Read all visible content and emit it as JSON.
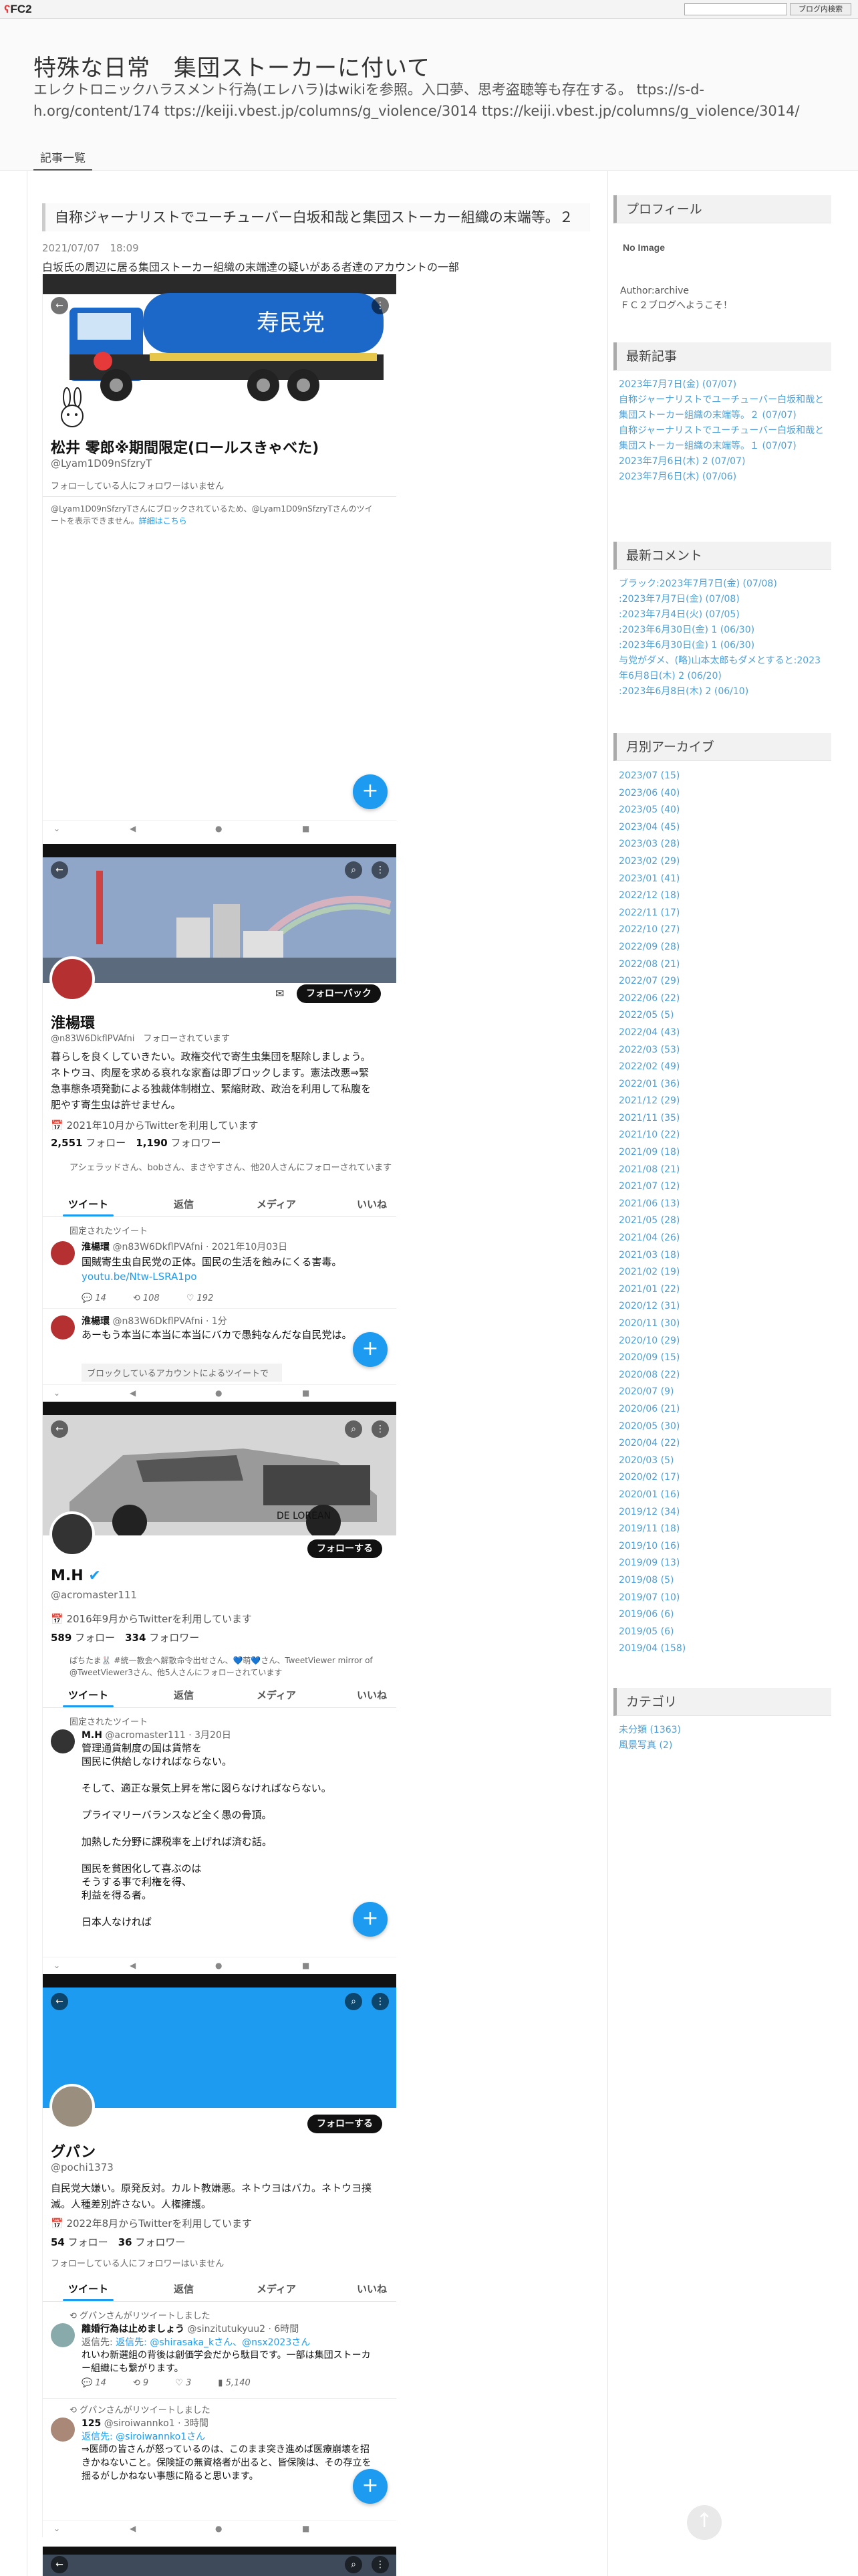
{
  "fc2": {
    "logo": "FC2",
    "search_button": "ブログ内検索"
  },
  "blog": {
    "title": "特殊な日常　集団ストーカーに付いて",
    "description": "エレクトロニックハラスメント行為(エレハラ)はwikiを参照。入口夢、思考盗聴等も存在する。 ttps://s-d-h.org/content/174 ttps://keiji.vbest.jp/columns/g_violence/3014 ttps://keiji.vbest.jp/columns/g_violence/3014/",
    "entry_list": "記事一覧"
  },
  "post": {
    "title": "自称ジャーナリストでユーチューバー白坂和哉と集団ストーカー組織の末端等。２",
    "date": "2021/07/07　18:09",
    "caption": "白坂氏の周辺に居る集団ストーカー組織の末端達の疑いがある者達のアカウントの一部"
  },
  "shot1": {
    "truck_text": "寿民党",
    "name": "松井 零郎※期間限定(ロールスきゃべた)",
    "handle": "@Lyam1D09nSfzryT",
    "follow_note": "フォローしている人にフォロワーはいません",
    "blocked": "@Lyam1D09nSfzryTさんにブロックされているため、@Lyam1D09nSfzryTさんのツイートを表示できません。",
    "blocked_link": "詳細はこちら"
  },
  "shot2": {
    "follow_back": "フォローバック",
    "name": "淮楊環",
    "handle": "@n83W6DkflPVAfni",
    "followed_badge": "フォローされています",
    "bio": "暮らしを良くしていきたい。政権交代で寄生虫集団を駆除しましょう。ネトウヨ、肉屋を求める哀れな家畜は即ブロックします。憲法改悪⇒緊急事態条項発動による独裁体制樹立、緊縮財政、政治を利用して私腹を肥やす寄生虫は許せません。",
    "joined": "2021年10月からTwitterを利用しています",
    "following": "2,551",
    "following_label": "フォロー",
    "followers": "1,190",
    "followers_label": "フォロワー",
    "followed_by": "アシェラッドさん、bobさん、まさやすさん、他20人さんにフォローされています",
    "tabs": [
      "ツイート",
      "返信",
      "メディア",
      "いいね"
    ],
    "pinned": "固定されたツイート",
    "tweet1_header": "淮楊環",
    "tweet1_meta": "@n83W6DkflPVAfni · 2021年10月03日",
    "tweet1_body": "国賊寄生虫自民党の正体。国民の生活を蝕みにくる害毒。",
    "tweet1_link": "youtu.be/Ntw-LSRA1po",
    "tweet1_stats": [
      "14",
      "108",
      "192"
    ],
    "tweet2_header": "淮楊環",
    "tweet2_meta": "@n83W6DkflPVAfni · 1分",
    "tweet2_body": "あーもう本当に本当に本当にバカで愚鈍なんだな自民党は。",
    "tweet2_blocked": "ブロックしているアカウントによるツイートで"
  },
  "shot3": {
    "car_text": "DE LOREAN",
    "follow_button": "フォローする",
    "name": "M.H",
    "handle": "@acromaster111",
    "joined": "2016年9月からTwitterを利用しています",
    "following": "589",
    "following_label": "フォロー",
    "followers": "334",
    "followers_label": "フォロワー",
    "followed_by": "ぱちたま🐰 #統一教会へ解散命令出せさん、💙萌💙さん、TweetViewer mirror of @TweetViewer3さん、他5人さんにフォローされています",
    "tabs": [
      "ツイート",
      "返信",
      "メディア",
      "いいね"
    ],
    "pinned": "固定されたツイート",
    "tweet_header": "M.H",
    "tweet_meta": "@acromaster111 · 3月20日",
    "tweet_lines": [
      "管理通貨制度の国は貨幣を",
      "国民に供給しなければならない。",
      "",
      "そして、適正な景気上昇を常に図らなければならない。",
      "",
      "プライマリーバランスなど全く愚の骨頂。",
      "",
      "加熱した分野に課税率を上げれば済む話。",
      "",
      "国民を貧困化して喜ぶのは",
      "そうする事で利権を得、",
      "利益を得る者。",
      "",
      "日本人なければ"
    ]
  },
  "shot4": {
    "follow_button": "フォローする",
    "name": "グパン",
    "handle": "@pochi1373",
    "bio": "自民党大嫌い。原発反対。カルト教嫌悪。ネトウヨはバカ。ネトウヨ撲滅。人種差別許さない。人権擁護。",
    "joined": "2022年8月からTwitterを利用しています",
    "following": "54",
    "following_label": "フォロー",
    "followers": "36",
    "followers_label": "フォロワー",
    "follow_note": "フォローしている人にフォロワーはいません",
    "tabs": [
      "ツイート",
      "返信",
      "メディア",
      "いいね"
    ],
    "retweet1": "グパンさんがリツイートしました",
    "tweet1_header": "離婚行為は止めましょう",
    "tweet1_meta": "@sinzitutukyuu2 · 6時間",
    "tweet1_reply": "返信先: @shirasaka_kさん、@nsx2023さん",
    "tweet1_body": "れいわ新選組の背後は創価学会だから駄目です。一部は集団ストーカー組織にも繋がります。",
    "tweet1_stats": [
      "14",
      "9",
      "3",
      "5,140"
    ],
    "retweet2": "グパンさんがリツイートしました",
    "tweet2_header": "125",
    "tweet2_meta": "@siroiwannko1 · 3時間",
    "tweet2_reply": "返信先: @siroiwannko1さん",
    "tweet2_body": "⇒医師の皆さんが怒っているのは、このまま突き進めば医療崩壊を招きかねないこと。保険証の無資格者が出ると、皆保険は、その存立を揺るがしかねない事態に陥ると思います。"
  },
  "sidebar": {
    "profile_title": "プロフィール",
    "no_image": "No Image",
    "author": "Author:archive",
    "welcome": "ＦＣ２ブログへようこそ！",
    "recent_title": "最新記事",
    "recent": [
      "2023年7月7日(金) (07/07)",
      "自称ジャーナリストでユーチューバー白坂和哉と集団ストーカー組織の末端等。２ (07/07)",
      "自称ジャーナリストでユーチューバー白坂和哉と集団ストーカー組織の末端等。１ (07/07)",
      "2023年7月6日(木) 2 (07/07)",
      "2023年7月6日(木) (07/06)"
    ],
    "comments_title": "最新コメント",
    "comments": [
      "ブラック:2023年7月7日(金) (07/08)",
      ":2023年7月7日(金) (07/08)",
      ":2023年7月4日(火) (07/05)",
      ":2023年6月30日(金) 1 (06/30)",
      ":2023年6月30日(金) 1 (06/30)",
      "与党がダメ、(略)山本太郎もダメとすると:2023年6月8日(木) 2 (06/20)",
      ":2023年6月8日(木) 2 (06/10)"
    ],
    "archive_title": "月別アーカイブ",
    "archives": [
      "2023/07 (15)",
      "2023/06 (40)",
      "2023/05 (40)",
      "2023/04 (45)",
      "2023/03 (28)",
      "2023/02 (29)",
      "2023/01 (41)",
      "2022/12 (18)",
      "2022/11 (17)",
      "2022/10 (27)",
      "2022/09 (28)",
      "2022/08 (21)",
      "2022/07 (29)",
      "2022/06 (22)",
      "2022/05 (5)",
      "2022/04 (43)",
      "2022/03 (53)",
      "2022/02 (49)",
      "2022/01 (36)",
      "2021/12 (29)",
      "2021/11 (35)",
      "2021/10 (22)",
      "2021/09 (18)",
      "2021/08 (21)",
      "2021/07 (12)",
      "2021/06 (13)",
      "2021/05 (28)",
      "2021/04 (26)",
      "2021/03 (18)",
      "2021/02 (19)",
      "2021/01 (22)",
      "2020/12 (31)",
      "2020/11 (30)",
      "2020/10 (29)",
      "2020/09 (15)",
      "2020/08 (22)",
      "2020/07 (9)",
      "2020/06 (21)",
      "2020/05 (30)",
      "2020/04 (22)",
      "2020/03 (5)",
      "2020/02 (17)",
      "2020/01 (16)",
      "2019/12 (34)",
      "2019/11 (18)",
      "2019/10 (16)",
      "2019/09 (13)",
      "2019/08 (5)",
      "2019/07 (10)",
      "2019/06 (6)",
      "2019/05 (6)",
      "2019/04 (158)"
    ],
    "category_title": "カテゴリ",
    "categories": [
      "未分類 (1363)",
      "風景写真 (2)"
    ]
  },
  "colors": {
    "accent": "#1d9bf0",
    "link": "#4d9fd6",
    "truck": "#1c68c9"
  }
}
